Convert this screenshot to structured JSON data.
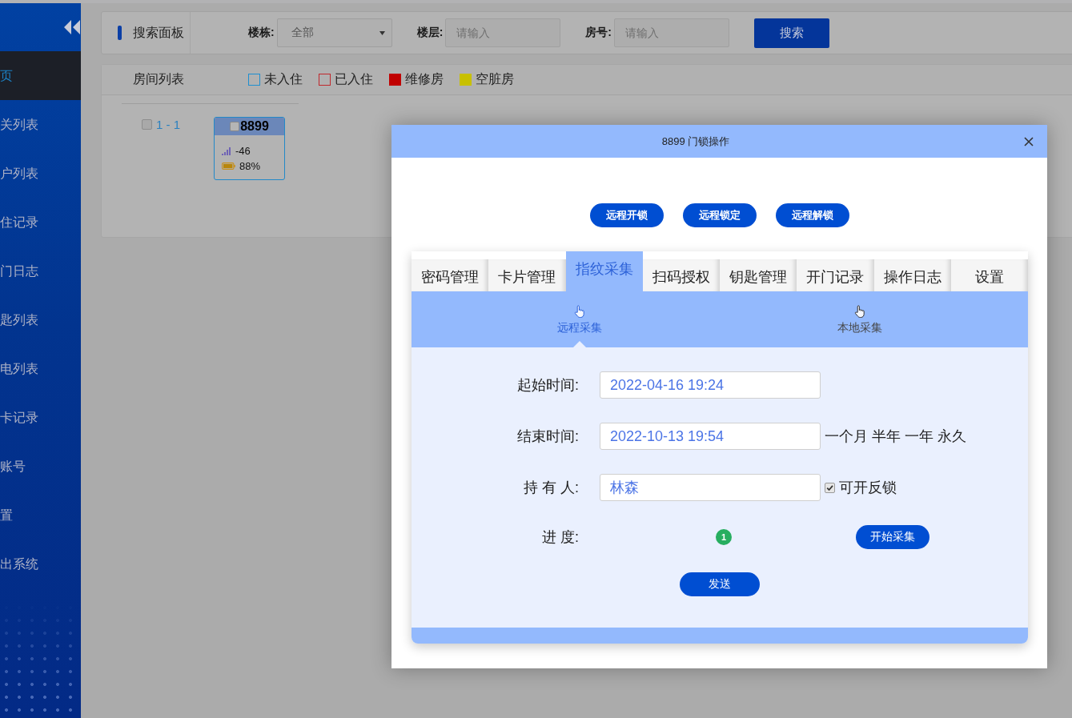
{
  "sidebar": {
    "items": [
      {
        "label": "页",
        "selected": true
      },
      {
        "label": "关列表",
        "selected": false
      },
      {
        "label": "户列表",
        "selected": false
      },
      {
        "label": "住记录",
        "selected": false
      },
      {
        "label": "门日志",
        "selected": false
      },
      {
        "label": "匙列表",
        "selected": false
      },
      {
        "label": "电列表",
        "selected": false
      },
      {
        "label": "卡记录",
        "selected": false
      },
      {
        "label": "账号",
        "selected": false
      },
      {
        "label": "置",
        "selected": false
      },
      {
        "label": "出系统",
        "selected": false
      }
    ]
  },
  "search_panel": {
    "title": "搜索面板",
    "filters": [
      {
        "kind": "select",
        "label": "楼栋:",
        "value": "全部"
      },
      {
        "kind": "text",
        "label": "楼层:",
        "placeholder": "请输入"
      },
      {
        "kind": "text",
        "label": "房号:",
        "placeholder": "请输入"
      }
    ],
    "button": "搜索"
  },
  "room_list": {
    "title": "房间列表",
    "legend": [
      {
        "kind": "outline",
        "label": "未入住",
        "color": "#1e8fd0"
      },
      {
        "kind": "outline",
        "label": "已入住",
        "color": "#c0282d"
      },
      {
        "kind": "filled",
        "label": "维修房",
        "color": "#c00000"
      },
      {
        "kind": "filled",
        "label": "空脏房",
        "color": "#c8c000"
      }
    ],
    "groups": [
      {
        "label": "1 - 1",
        "checked": false,
        "rooms": [
          {
            "number": "8899",
            "checked": false,
            "signal": "-46",
            "battery": "88%"
          }
        ]
      }
    ]
  },
  "dialog": {
    "title": "8899 门锁操作",
    "actions": [
      "远程开锁",
      "远程锁定",
      "远程解锁"
    ],
    "tabs": [
      {
        "label": "密码管理",
        "selected": false
      },
      {
        "label": "卡片管理",
        "selected": false
      },
      {
        "label": "指纹采集",
        "selected": true
      },
      {
        "label": "扫码授权",
        "selected": false
      },
      {
        "label": "钥匙管理",
        "selected": false
      },
      {
        "label": "开门记录",
        "selected": false
      },
      {
        "label": "操作日志",
        "selected": false
      },
      {
        "label": "设置",
        "selected": false
      }
    ],
    "subtabs": [
      {
        "label": "远程采集",
        "selected": true
      },
      {
        "label": "本地采集",
        "selected": false
      }
    ],
    "form": {
      "start_time": {
        "label": "起始时间:",
        "value": "2022-04-16 19:24"
      },
      "end_time": {
        "label": "结束时间:",
        "value": "2022-10-13 19:54",
        "presets": [
          "一个月",
          "半年",
          "一年",
          "永久"
        ]
      },
      "holder": {
        "label": "持 有 人:",
        "value": "林森",
        "option": {
          "label": "可开反锁",
          "checked": true
        }
      },
      "progress": {
        "label": "进 度:",
        "steps": [
          "1"
        ],
        "button": "开始采集"
      },
      "submit": "发送"
    }
  }
}
